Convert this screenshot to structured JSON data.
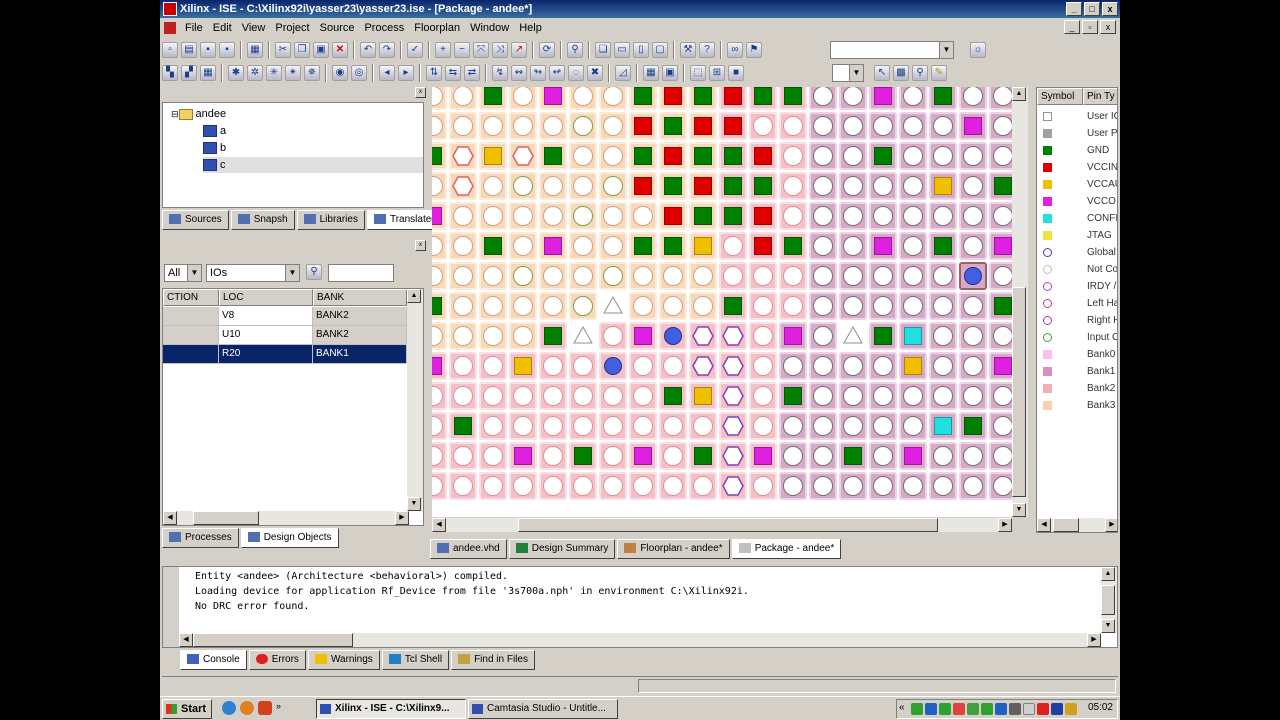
{
  "window": {
    "title": "Xilinx - ISE - C:\\Xilinx92i\\yasser23\\yasser23.ise - [Package - andee*]"
  },
  "menu": [
    "File",
    "Edit",
    "View",
    "Project",
    "Source",
    "Process",
    "Floorplan",
    "Window",
    "Help"
  ],
  "sources": {
    "root": "andee",
    "children": [
      "a",
      "b",
      "c"
    ],
    "tabs": [
      "Sources",
      "Snapsh",
      "Libraries",
      "Translated N"
    ]
  },
  "design_objects": {
    "filter_all": "All",
    "filter_type": "IOs",
    "columns": [
      "CTION",
      "LOC",
      "BANK"
    ],
    "rows": [
      {
        "dir": "",
        "loc": "V8",
        "bank": "BANK2"
      },
      {
        "dir": "",
        "loc": "U10",
        "bank": "BANK2"
      },
      {
        "dir": "",
        "loc": "R20",
        "bank": "BANK1"
      }
    ],
    "tabs": [
      "Processes",
      "Design Objects"
    ]
  },
  "editor_tabs": [
    "andee.vhd",
    "Design Summary",
    "Floorplan - andee*",
    "Package - andee*"
  ],
  "legend": {
    "columns": [
      "Symbol",
      "Pin Ty"
    ],
    "items": [
      {
        "label": "User IC",
        "color": "#ffffff",
        "shape": "square-outline"
      },
      {
        "label": "User Pi",
        "color": "#a0a0a0",
        "shape": "square"
      },
      {
        "label": "GND",
        "color": "#008000",
        "shape": "square"
      },
      {
        "label": "VCCINT",
        "color": "#e00000",
        "shape": "square"
      },
      {
        "label": "VCCAU",
        "color": "#f0c000",
        "shape": "square"
      },
      {
        "label": "VCCO",
        "color": "#e020e0",
        "shape": "square"
      },
      {
        "label": "CONFIG",
        "color": "#20e0e0",
        "shape": "square"
      },
      {
        "label": "JTAG",
        "color": "#f0e040",
        "shape": "square"
      },
      {
        "label": "Global",
        "color": "#4040c0",
        "shape": "circle"
      },
      {
        "label": "Not Co",
        "color": "#c0c0c0",
        "shape": "circle"
      },
      {
        "label": "IRDY /",
        "color": "#c040c0",
        "shape": "circle"
      },
      {
        "label": "Left Ha",
        "color": "#c04080",
        "shape": "circle"
      },
      {
        "label": "Right H",
        "color": "#a040a0",
        "shape": "circle"
      },
      {
        "label": "Input O",
        "color": "#40a040",
        "shape": "circle"
      },
      {
        "label": "Bank0",
        "color": "#f8c0f0",
        "shape": "square"
      },
      {
        "label": "Bank1",
        "color": "#d890c0",
        "shape": "square"
      },
      {
        "label": "Bank2",
        "color": "#f4b0b8",
        "shape": "square"
      },
      {
        "label": "Bank3",
        "color": "#f8d0b0",
        "shape": "square"
      }
    ]
  },
  "console": {
    "lines": [
      "Entity <andee> (Architecture <behavioral>) compiled.",
      "Loading device for application Rf_Device from file '3s700a.nph' in environment C:\\Xilinx92i.",
      "No DRC error found."
    ],
    "tabs": [
      "Console",
      "Errors",
      "Warnings",
      "Tcl Shell",
      "Find in Files"
    ]
  },
  "taskbar": {
    "start": "Start",
    "buttons": [
      "Xilinx - ISE - C:\\Xilinx9...",
      "Camtasia Studio - Untitle..."
    ],
    "clock": "05:02"
  },
  "colors": {
    "bank3": "#f8d8b8",
    "bank2": "#f4c0c8",
    "bank1": "#d8a8c8",
    "bank0": "#f8c8f0",
    "gnd": "#008000",
    "vccint": "#e00000",
    "vccaux": "#f0c000",
    "vcco": "#e020e0",
    "config": "#20e0e0",
    "global": "#4060e0"
  }
}
